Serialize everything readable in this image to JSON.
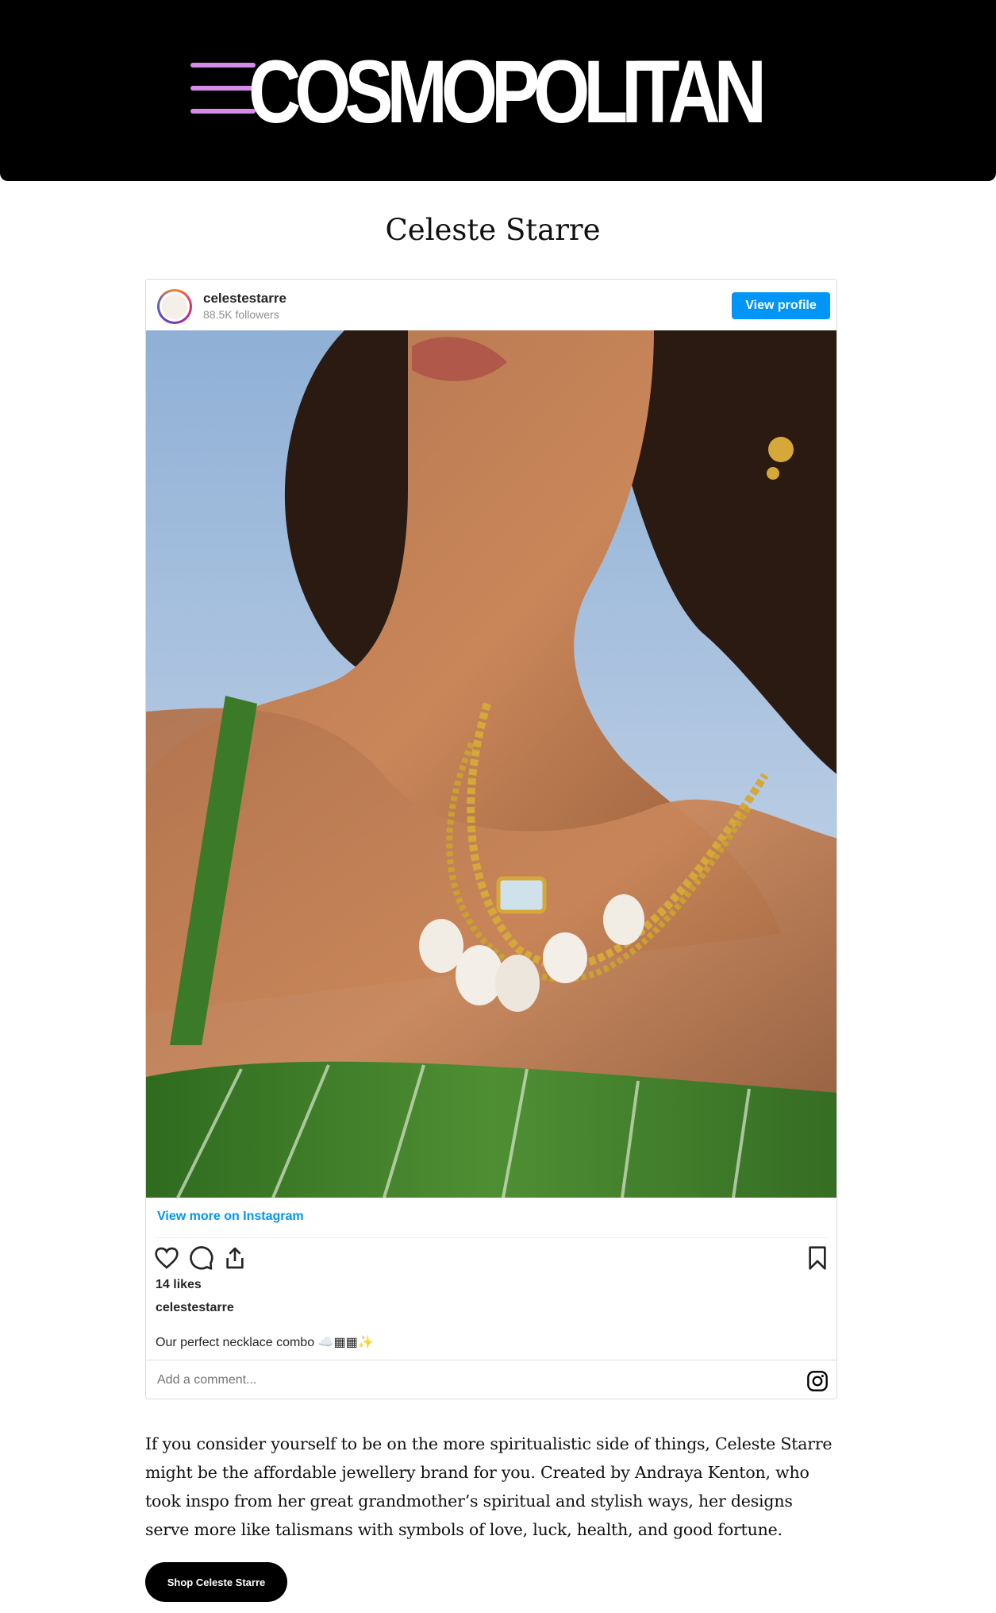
{
  "header": {
    "logo_text": "COSMOPOLITAN",
    "menu_icon": "hamburger-icon",
    "menu_color": "#d58be8",
    "background": "#000000"
  },
  "section": {
    "title": "Celeste Starre"
  },
  "instagram": {
    "username": "celestestarre",
    "followers": "88.5K followers",
    "view_profile_label": "View profile",
    "view_more_label": "View more on Instagram",
    "likes": "14 likes",
    "caption_user": "celestestarre",
    "caption_text": "Our perfect necklace combo ☁️▦▦✨",
    "comment_placeholder": "Add a comment...",
    "icons": [
      "heart-icon",
      "comment-icon",
      "share-icon",
      "bookmark-icon",
      "instagram-logo-icon"
    ],
    "accent": "#0095f6"
  },
  "article": {
    "paragraph": "If you consider yourself to be on the more spiritualistic side of things, Celeste Starre might be the affordable jewellery brand for you. Created by Andraya Kenton, who took inspo from her great grandmother’s spiritual and stylish ways, her designs serve more like talismans with symbols of love, luck, health, and good fortune.",
    "shop_button_label": "Shop Celeste Starre"
  }
}
